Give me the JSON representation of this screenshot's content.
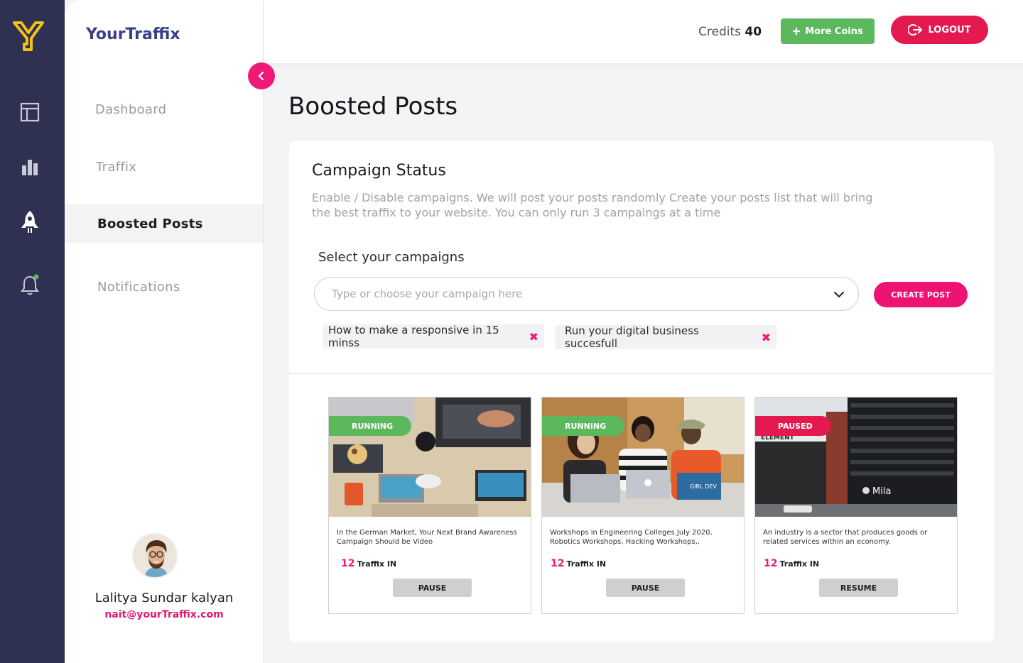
{
  "app": {
    "brand": "YourTraffix"
  },
  "sidebar": {
    "items": [
      {
        "label": "Dashboard"
      },
      {
        "label": "Traffix"
      },
      {
        "label": "Boosted Posts"
      },
      {
        "label": "Notifications"
      }
    ]
  },
  "user": {
    "name": "Lalitya Sundar kalyan",
    "email": "nait@yourTraffix.com"
  },
  "header": {
    "credits_label": "Credits",
    "credits_value": "40",
    "more_coins_label": "More Coins",
    "logout_label": "LOGOUT"
  },
  "page": {
    "title": "Boosted Posts"
  },
  "campaign": {
    "title": "Campaign Status",
    "description": "Enable / Disable campaigns. We will post your posts randomly Create your posts list that will bring the best traffix to your website. You can only run 3 campaings at a time",
    "select_label": "Select your campaigns",
    "select_placeholder": "Type or choose your campaign here",
    "create_post_label": "CREATE POST",
    "chips": [
      {
        "label": "How to make a responsive in 15 minss",
        "remove": "✖"
      },
      {
        "label": "Run your digital business succesfull",
        "remove": "✖"
      }
    ]
  },
  "posts": [
    {
      "status": "RUNNING",
      "status_color": "#5cb85c",
      "text": "In the German Market, Your Next Brand Awareness Campaign Should be Video",
      "traffix_count": "12",
      "traffix_label": "Traffix IN",
      "action": "PAUSE"
    },
    {
      "status": "RUNNING",
      "status_color": "#5cb85c",
      "text": "Workshops in Engineering Colleges July 2020, Robotics Workshops, Hacking Workshops,.",
      "traffix_count": "12",
      "traffix_label": "Traffix IN",
      "action": "PAUSE"
    },
    {
      "status": "PAUSED",
      "status_color": "#e3194f",
      "text": "An industry is a sector that produces goods or related services within an economy.",
      "traffix_count": "12",
      "traffix_label": "Traffix IN",
      "action": "RESUME"
    }
  ],
  "images": {
    "post3_sign_top": "ELEMENT",
    "post3_sign_mila": "Mila",
    "post2_sticker": "GIRL DEV"
  },
  "colors": {
    "rail": "#2e3151",
    "accent_pink": "#ee1a76",
    "green": "#5cb85c",
    "red": "#e3194f",
    "logo_yellow": "#f2c21b"
  },
  "icons": {
    "logo": "y-logo-icon",
    "dashboard": "layout-icon",
    "traffix": "bar-chart-icon",
    "boosted": "rocket-icon",
    "notifications": "bell-icon"
  }
}
